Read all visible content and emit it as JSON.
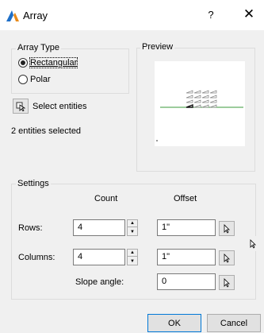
{
  "window": {
    "title": "Array",
    "help_label": "?",
    "close_label": "✕"
  },
  "array_type": {
    "group_label": "Array Type",
    "options": [
      {
        "label": "Rectangular",
        "selected": true
      },
      {
        "label": "Polar",
        "selected": false
      }
    ]
  },
  "preview": {
    "group_label": "Preview"
  },
  "selection": {
    "button_label": "Select entities",
    "status": "2 entities selected"
  },
  "settings": {
    "group_label": "Settings",
    "count_header": "Count",
    "offset_header": "Offset",
    "rows_label": "Rows:",
    "rows_count": "4",
    "rows_offset": "1\"",
    "columns_label": "Columns:",
    "columns_count": "4",
    "columns_offset": "1\"",
    "slope_label": "Slope angle:",
    "slope_value": "0"
  },
  "footer": {
    "ok_label": "OK",
    "cancel_label": "Cancel"
  },
  "colors": {
    "accent": "#0078d7",
    "preview_line": "#3a9a3a"
  }
}
